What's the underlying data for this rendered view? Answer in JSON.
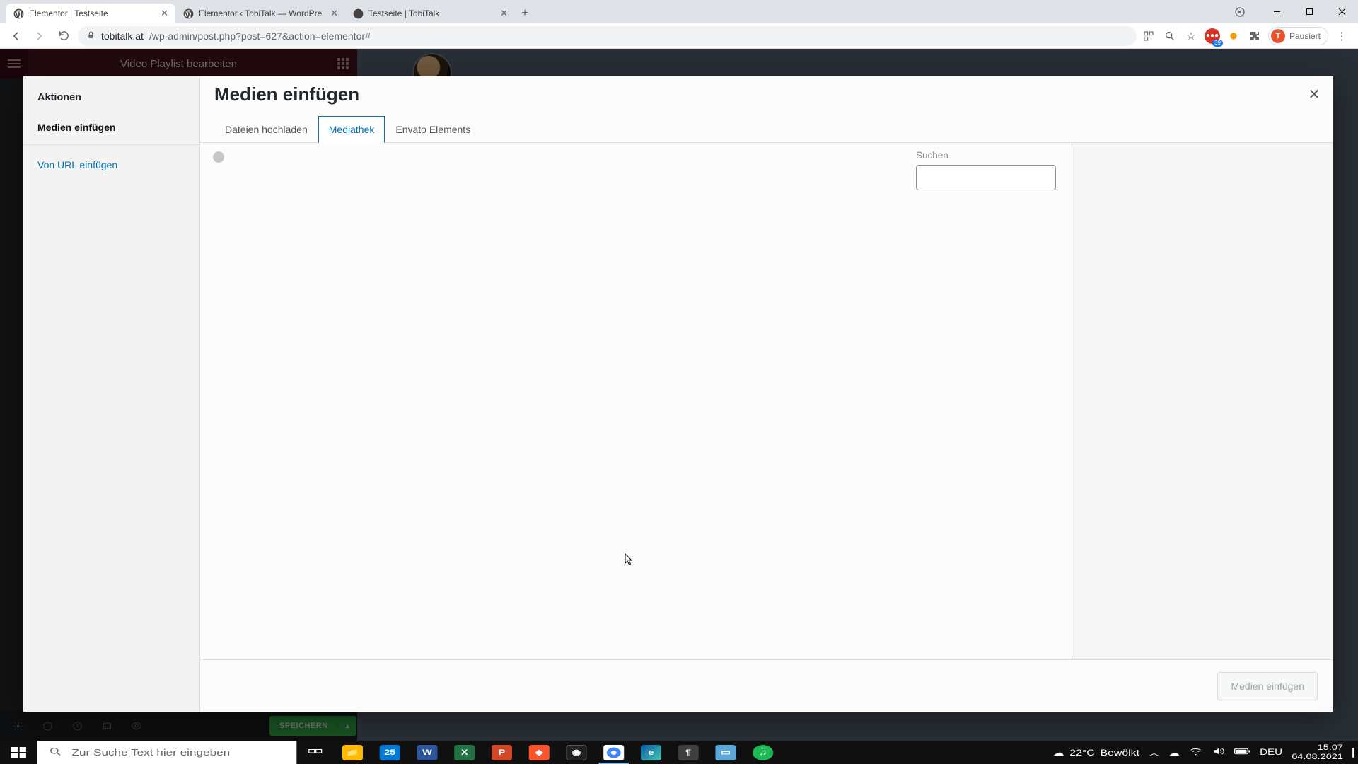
{
  "browser": {
    "tabs": [
      {
        "title": "Elementor | Testseite",
        "active": true
      },
      {
        "title": "Elementor ‹ TobiTalk — WordPre",
        "active": false
      },
      {
        "title": "Testseite | TobiTalk",
        "active": false
      }
    ],
    "url_host": "tobitalk.at",
    "url_path": "/wp-admin/post.php?post=627&action=elementor#",
    "profile_label": "Pausiert",
    "profile_initial": "T",
    "ext_badge": "39"
  },
  "elementor": {
    "panel_title": "Video Playlist bearbeiten",
    "save_label": "SPEICHERN"
  },
  "modal": {
    "sidebar_heading": "Aktionen",
    "action_insert": "Medien einfügen",
    "action_url": "Von URL einfügen",
    "title": "Medien einfügen",
    "tabs": {
      "upload": "Dateien hochladen",
      "library": "Mediathek",
      "envato": "Envato Elements"
    },
    "search_label": "Suchen",
    "insert_button": "Medien einfügen"
  },
  "taskbar": {
    "search_placeholder": "Zur Suche Text hier eingeben",
    "weather_temp": "22°C",
    "weather_cond": "Bewölkt",
    "lang": "DEU",
    "time": "15:07",
    "date": "04.08.2021"
  }
}
